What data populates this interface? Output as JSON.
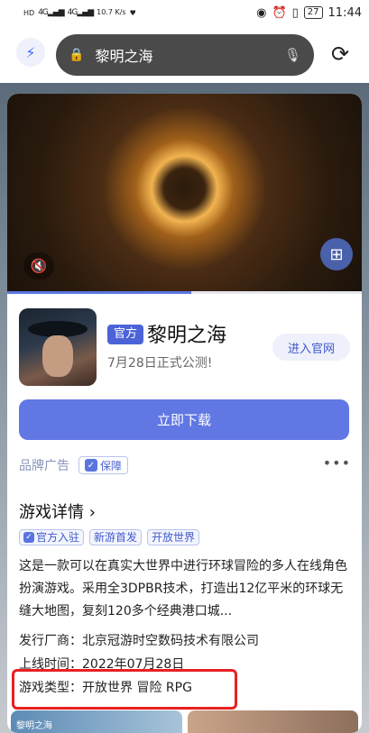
{
  "status_bar": {
    "network_left": "HD",
    "signal_1": "4G",
    "signal_2": "4G",
    "speed": "10.7\nK/s",
    "battery": "27",
    "time": "11:44"
  },
  "browser": {
    "query": "黎明之海"
  },
  "game": {
    "official_badge": "官方",
    "title": "黎明之海",
    "subtitle": "7月28日正式公测!",
    "site_button": "进入官网",
    "download_button": "立即下载",
    "video_progress": 0.52
  },
  "ad": {
    "label": "品牌广告",
    "guarantee": "保障"
  },
  "details": {
    "title": "游戏详情",
    "tags": [
      "官方入驻",
      "新游首发",
      "开放世界"
    ],
    "description": "这是一款可以在真实大世界中进行环球冒险的多人在线角色扮演游戏。采用全3DPBR技术，打造出12亿平米的环球无缝大地图，复刻120多个经典港口城...",
    "publisher": "发行厂商：北京冠游时空数码技术有限公司",
    "launch": "上线时间：2022年07月28日",
    "genre": "游戏类型：开放世界 冒险 RPG"
  },
  "thumb_caption": "黎明之海",
  "colors": {
    "accent": "#6177e3",
    "badge": "#4c63d8",
    "highlight_box": "#e82020"
  }
}
